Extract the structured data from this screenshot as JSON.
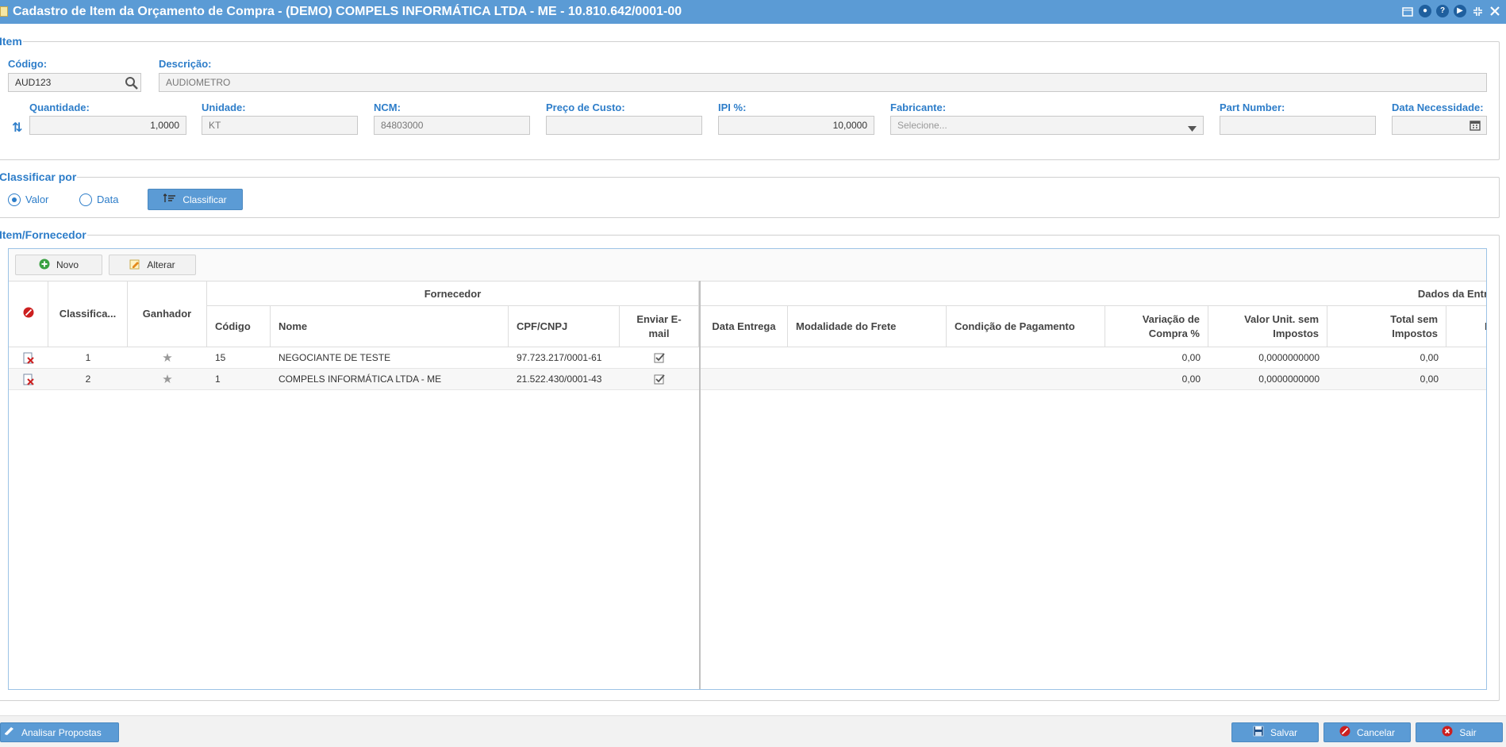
{
  "window": {
    "title": "Cadastro de Item da Orçamento de Compra - (DEMO) COMPELS INFORMÁTICA LTDA - ME - 10.810.642/0001-00"
  },
  "item_section": {
    "legend": "Item",
    "codigo": {
      "label": "Código:",
      "value": "AUD123"
    },
    "descricao": {
      "label": "Descrição:",
      "value": "AUDIOMETRO"
    },
    "quantidade": {
      "label": "Quantidade:",
      "value": "1,0000"
    },
    "unidade": {
      "label": "Unidade:",
      "value": "KT"
    },
    "ncm": {
      "label": "NCM:",
      "value": "84803000"
    },
    "preco_custo": {
      "label": "Preço de Custo:",
      "value": ""
    },
    "ipi": {
      "label": "IPI %:",
      "value": "10,0000"
    },
    "fabricante": {
      "label": "Fabricante:",
      "placeholder": "Selecione..."
    },
    "part_number": {
      "label": "Part Number:",
      "value": ""
    },
    "data_necessidade": {
      "label": "Data Necessidade:",
      "value": ""
    }
  },
  "classificar_section": {
    "legend": "Classificar por",
    "options": [
      {
        "label": "Valor",
        "selected": true
      },
      {
        "label": "Data",
        "selected": false
      }
    ],
    "button_label": "Classificar"
  },
  "fornecedor_section": {
    "legend": "Item/Fornecedor",
    "toolbar": {
      "novo": "Novo",
      "alterar": "Alterar"
    },
    "group_headers": {
      "fornecedor": "Fornecedor",
      "dados_entrega": "Dados da Entr"
    },
    "columns": {
      "classificacao": "Classifica...",
      "ganhador": "Ganhador",
      "codigo": "Código",
      "nome": "Nome",
      "cpf_cnpj": "CPF/CNPJ",
      "enviar_email": "Enviar E-mail",
      "data_entrega": "Data Entrega",
      "modalidade_frete": "Modalidade do Frete",
      "condicao_pagamento": "Condição de Pagamento",
      "variacao_compra": "Variação de Compra %",
      "valor_unit": "Valor Unit. sem Impostos",
      "total_sem_impostos": "Total sem Impostos",
      "frete_partial": "Fr"
    },
    "rows": [
      {
        "classificacao": "1",
        "codigo": "15",
        "nome": "NEGOCIANTE DE TESTE",
        "cpf_cnpj": "97.723.217/0001-61",
        "enviar_email": true,
        "data_entrega": "",
        "modalidade_frete": "",
        "condicao_pagamento": "",
        "variacao": "0,00",
        "valor_unit": "0,0000000000",
        "total": "0,00"
      },
      {
        "classificacao": "2",
        "codigo": "1",
        "nome": "COMPELS INFORMÁTICA LTDA - ME",
        "cpf_cnpj": "21.522.430/0001-43",
        "enviar_email": true,
        "data_entrega": "",
        "modalidade_frete": "",
        "condicao_pagamento": "",
        "variacao": "0,00",
        "valor_unit": "0,0000000000",
        "total": "0,00"
      }
    ]
  },
  "footer": {
    "analisar": "Analisar Propostas",
    "salvar": "Salvar",
    "cancelar": "Cancelar",
    "sair": "Sair"
  },
  "colors": {
    "accent": "#5b9bd5",
    "label_blue": "#2d7dc9",
    "danger": "#cc1f1f"
  }
}
